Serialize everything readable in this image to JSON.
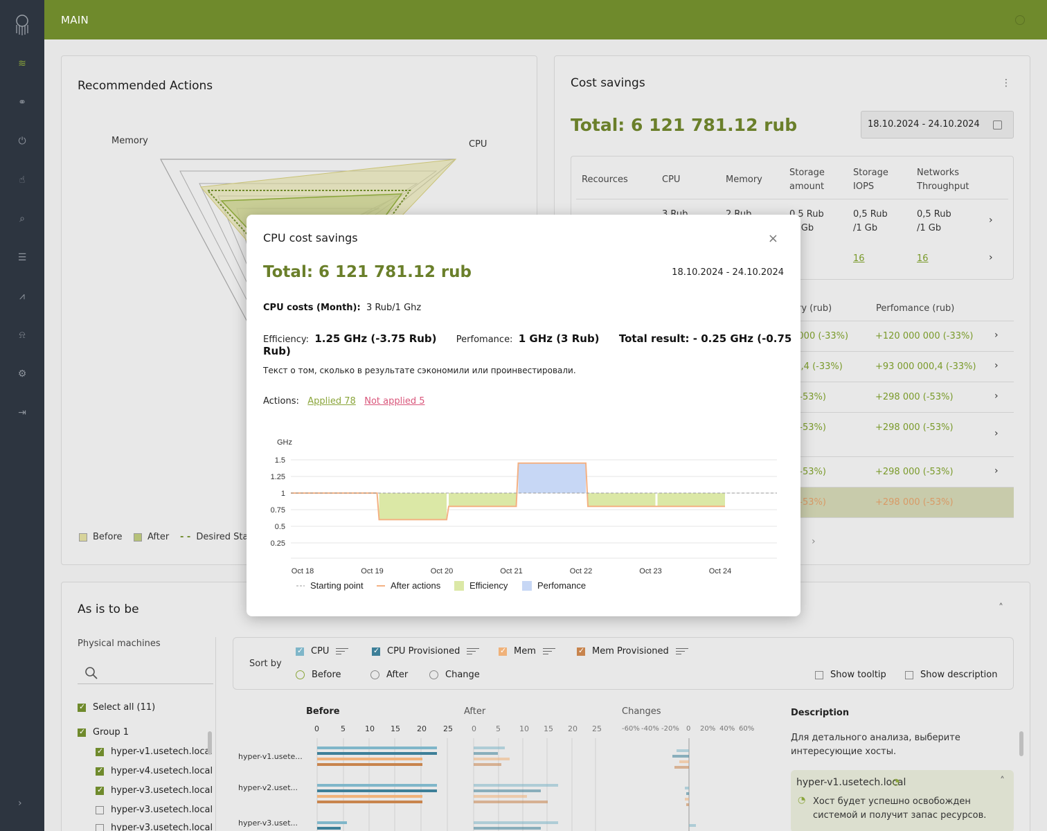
{
  "topbar": {
    "title": "MAIN"
  },
  "sidebar": {
    "icons": [
      "logo-icon",
      "layers-icon",
      "nodes-icon",
      "power-icon",
      "hand-icon",
      "search-icon",
      "list-icon",
      "chart-icon",
      "bell-icon",
      "gear-icon",
      "logout-icon",
      "chevron-right-icon"
    ]
  },
  "recommended": {
    "title": "Recommended Actions",
    "axes": {
      "memory": "Memory",
      "cpu": "CPU"
    },
    "legend": {
      "before": "Before",
      "after": "After",
      "desired": "Desired State"
    }
  },
  "cost": {
    "title": "Cost savings",
    "total": "Total: 6 121 781.12 rub",
    "date_range": "18.10.2024 -  24.10.2024",
    "table": {
      "headers": [
        "Recources",
        "CPU",
        "Memory",
        "Storage amount",
        "Storage IOPS",
        "Networks Throughput"
      ],
      "row1": {
        "cpu": "3 Rub",
        "memory": "2 Rub",
        "storage_amount": "0,5 Rub /1 Gb",
        "storage_iops": "0,5 Rub /1 Gb",
        "network": "0,5 Rub /1 Gb"
      },
      "row2": {
        "storage_iops": "16",
        "network": "16"
      }
    },
    "summary_headers": {
      "efficiency": "ry (rub)",
      "performance": "Perfomance (rub)"
    },
    "summary_rows": [
      {
        "a": "0 000 (-33%)",
        "b": "+120 000 000 (-33%)"
      },
      {
        "a": "00,4 (-33%)",
        "b": "+93 000 000,4 (-33%)"
      },
      {
        "a": ") (-53%)",
        "b": "+298 000 (-53%)"
      },
      {
        "a": ") (-53%)",
        "b": "+298 000 (-53%)"
      },
      {
        "a": ") (-53%)",
        "b": "+298 000 (-53%)"
      },
      {
        "a": ") (-53%)",
        "b": "+298 000 (-53%)"
      }
    ]
  },
  "modal": {
    "title": "CPU cost savings",
    "total": "Total: 6 121 781.12 rub",
    "dates": "18.10.2024 -  24.10.2024",
    "cpu_costs_label": "CPU costs (Month):",
    "cpu_costs_value": "3 Rub/1 Ghz",
    "efficiency_label": "Efficiency:",
    "efficiency_value": "1.25 GHz (-3.75 Rub)",
    "performance_label": "Perfomance:",
    "performance_value": "1 GHz (3 Rub)",
    "total_result": "Total result: - 0.25 GHz (-0.75 Rub)",
    "note": "Текст о том, сколько в результате сэкономили или проинвестировали.",
    "actions_label": "Actions:",
    "applied": "Applied 78",
    "not_applied": "Not applied 5",
    "legend": {
      "start": "Starting point",
      "after": "After actions",
      "efficiency": "Efficiency",
      "performance": "Perfomance"
    }
  },
  "chart_data": {
    "type": "area",
    "ylabel": "GHz",
    "yticks": [
      "1.5",
      "1.25",
      "1",
      "0.75",
      "0.5",
      "0.25"
    ],
    "ylim": [
      0.25,
      1.5
    ],
    "categories": [
      "Oct 18",
      "Oct 19",
      "Oct 20",
      "Oct 21",
      "Oct 22",
      "Oct 23",
      "Oct 24"
    ],
    "starting_point": 1.0,
    "after_actions": [
      1.0,
      0.6,
      0.8,
      1.45,
      0.8,
      0.8
    ],
    "series": [
      {
        "name": "Starting point",
        "values": [
          1,
          1,
          1,
          1,
          1,
          1,
          1
        ]
      },
      {
        "name": "After actions",
        "values": [
          1.0,
          0.6,
          0.8,
          1.45,
          0.8,
          0.8
        ]
      }
    ],
    "legend_position": "bottom"
  },
  "as_is": {
    "title": "As is to be",
    "physical_machines": "Physical machines",
    "select_all": "Select all (11)",
    "group": "Group 1",
    "hosts": [
      "hyper-v1.usetech.local",
      "hyper-v4.usetech.local",
      "hyper-v3.usetech.local",
      "hyper-v3.usetech.local",
      "hyper-v3.usetech.local"
    ],
    "sort_by": "Sort by",
    "filters": [
      "CPU",
      "CPU Provisioned",
      "Mem",
      "Mem Provisioned"
    ],
    "radios": [
      "Before",
      "After",
      "Change"
    ],
    "show_tooltip": "Show tooltip",
    "show_description": "Show description",
    "col_before": "Before",
    "col_after": "After",
    "col_changes": "Changes",
    "ticks_before": [
      "0",
      "5",
      "10",
      "15",
      "20",
      "25"
    ],
    "ticks_changes": [
      "-60%",
      "-40%",
      "-20%",
      "0",
      "20%",
      "40%",
      "60%"
    ],
    "chart_hosts": [
      "hyper-v1.usete...",
      "hyper-v2.uset...",
      "hyper-v3.uset..."
    ],
    "description_title": "Description",
    "description_text": "Для детального анализа, выберите интересующие хосты.",
    "desc_host": "hyper-v1.usetech.local",
    "desc_msg": "Хост будет успешно освобожден системой и получит запас ресурсов."
  },
  "colors": {
    "accent": "#6f8a2c",
    "sidebar": "#2d3540",
    "efficiency": "#dbe8a6",
    "performance": "#c7d7f5",
    "after_line": "#f4b183"
  }
}
